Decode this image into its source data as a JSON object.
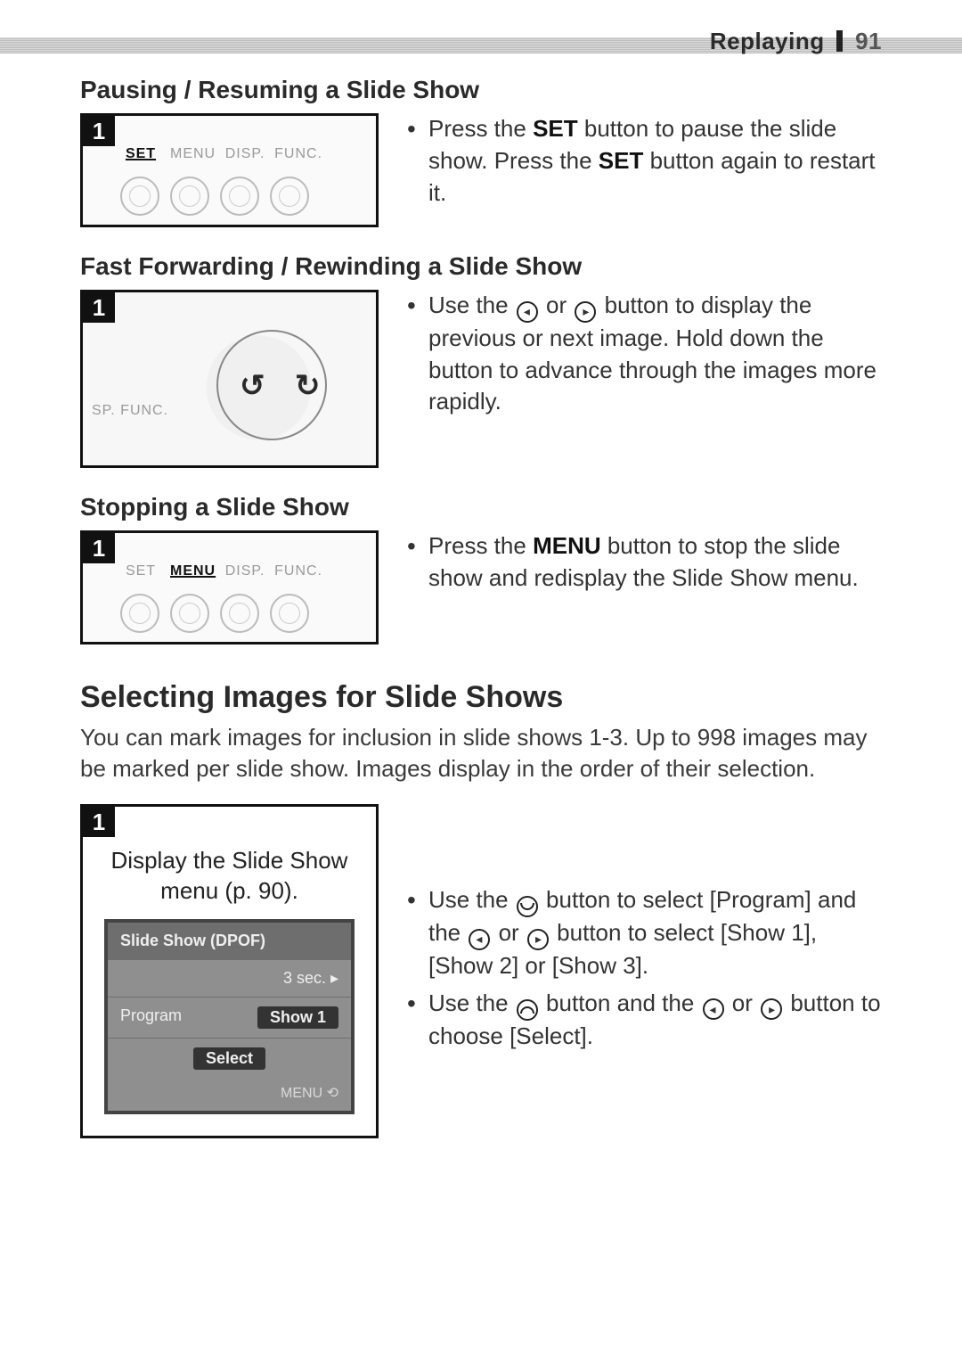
{
  "header": {
    "section": "Replaying",
    "page": "91"
  },
  "pausing": {
    "title": "Pausing / Resuming a Slide Show",
    "step": "1",
    "labels": {
      "set": "SET",
      "menu": "MENU",
      "disp": "DISP.",
      "func": "FUNC."
    },
    "bullet_pre": "Press the ",
    "bullet_strong1": "SET",
    "bullet_mid": " button to pause the slide show. Press the ",
    "bullet_strong2": "SET",
    "bullet_post": " button again to restart it."
  },
  "ffwd": {
    "title": "Fast Forwarding / Rewinding a Slide Show",
    "step": "1",
    "corner": "SP. FUNC.",
    "bullet_pre": "Use the ",
    "bullet_mid": " or ",
    "bullet_post": " button to display the previous or next image. Hold down the button to advance through the images more rapidly."
  },
  "stopping": {
    "title": "Stopping a Slide Show",
    "step": "1",
    "labels": {
      "set": "SET",
      "menu": "MENU",
      "disp": "DISP.",
      "func": "FUNC."
    },
    "bullet_pre": "Press the ",
    "bullet_strong": "MENU",
    "bullet_post": " button to stop the slide show and redisplay the Slide Show menu."
  },
  "selecting": {
    "title": "Selecting Images for Slide Shows",
    "intro": "You can mark images for inclusion in slide shows 1-3. Up to 998 images may be marked per slide show. Images display in the order of their selection.",
    "step": "1",
    "caption_line1": "Display the Slide Show",
    "caption_line2": "menu (p. 90).",
    "lcd": {
      "title": "Slide Show (DPOF)",
      "time": "3 sec. ▸",
      "program": "Program",
      "show": "Show 1",
      "select": "Select",
      "menu": "MENU ⟲"
    },
    "bullet1_a": "Use the ",
    "bullet1_b": " button to select [Program] and the ",
    "bullet1_c": " or ",
    "bullet1_d": " button to select [Show 1], [Show 2] or [Show 3].",
    "bullet2_a": "Use the ",
    "bullet2_b": " button and the ",
    "bullet2_c": " or ",
    "bullet2_d": " button to choose [Select]."
  }
}
